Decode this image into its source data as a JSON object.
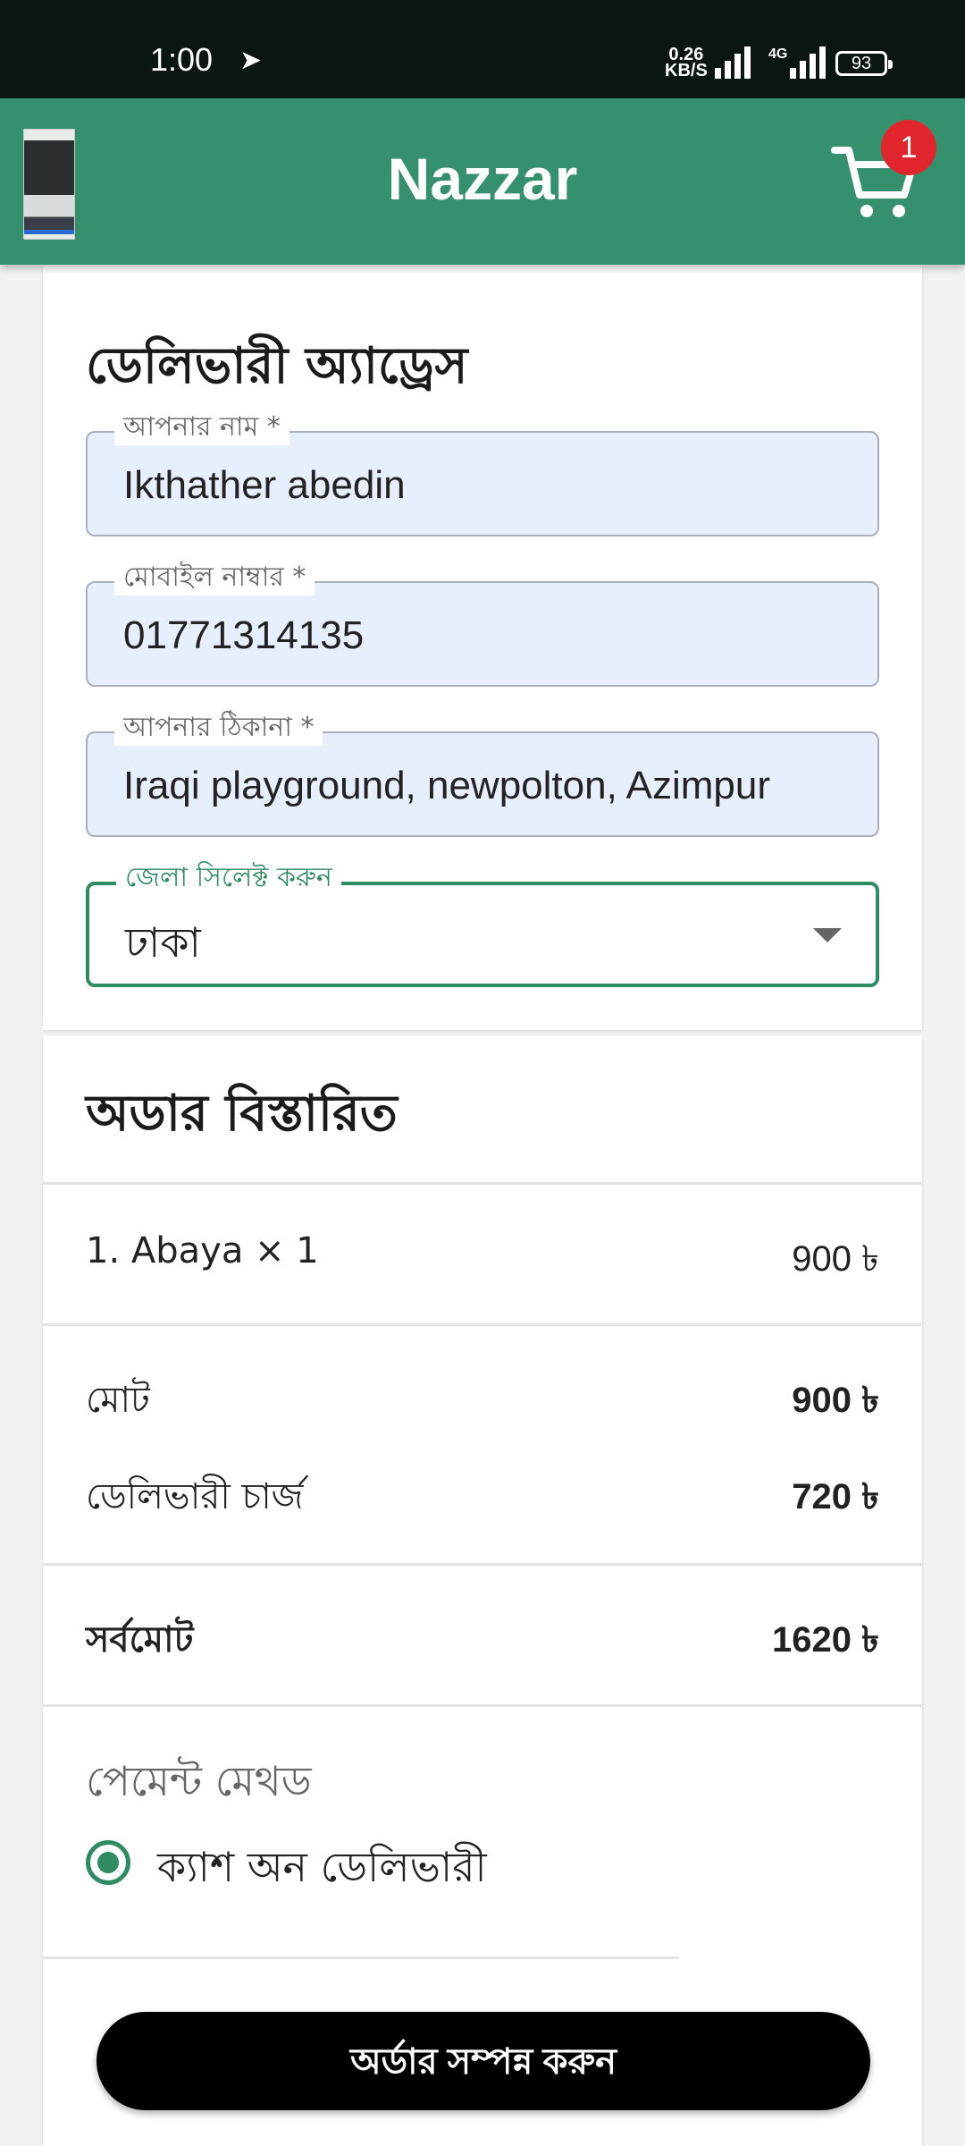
{
  "status_bar": {
    "time": "1:00",
    "speed_value": "0.26",
    "speed_unit": "KB/S",
    "network": "4G",
    "battery": "93"
  },
  "app_bar": {
    "title": "Nazzar",
    "cart_count": "1"
  },
  "address": {
    "title": "ডেলিভারী অ্যাড্রেস",
    "name_label": "আপনার নাম *",
    "name_value": "Ikthather abedin",
    "mobile_label": "মোবাইল নাম্বার *",
    "mobile_value": "01771314135",
    "address_label": "আপনার ঠিকানা *",
    "address_value": "Iraqi playground, newpolton, Azimpur",
    "district_label": "জেলা সিলেক্ট করুন",
    "district_value": "ঢাকা"
  },
  "order": {
    "title": "অডার বিস্তারিত",
    "item": "1. Abaya × 1",
    "item_price": "900 ৳",
    "subtotal_label": "মোট",
    "subtotal_value": "900 ৳",
    "delivery_label": "ডেলিভারী চার্জ",
    "delivery_value": "720 ৳",
    "total_label": "সর্বমোট",
    "total_value": "1620 ৳",
    "payment_title": "পেমেন্ট মেথড",
    "payment_option": "ক্যাশ অন ডেলিভারী",
    "submit_label": "অর্ডার সম্পন্ন করুন"
  },
  "colors": {
    "primary": "#35916d",
    "accent": "#2e8b62",
    "badge": "#e0262c",
    "field_bg": "#e7eefc"
  }
}
